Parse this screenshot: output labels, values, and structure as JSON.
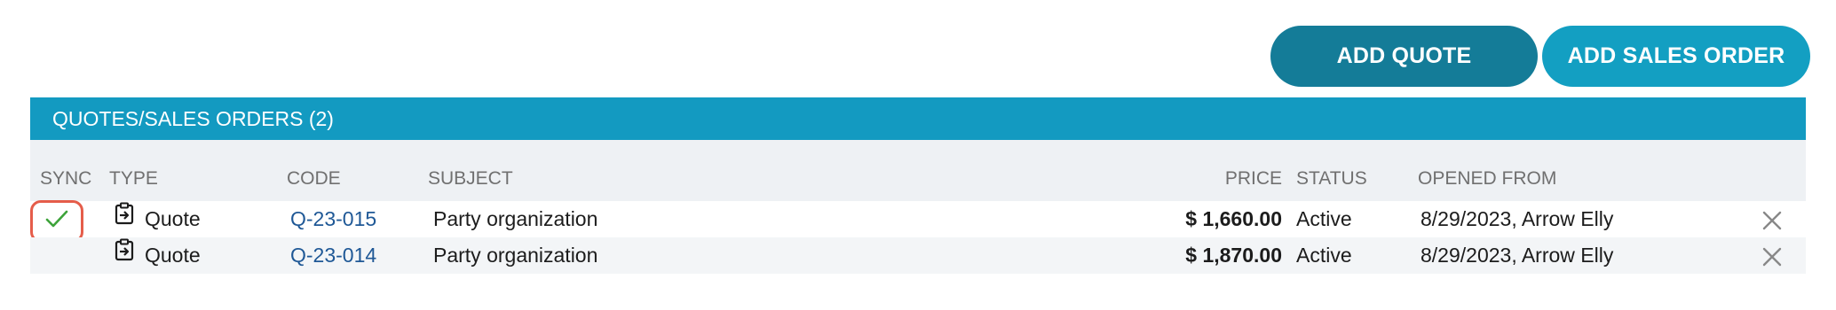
{
  "toolbar": {
    "add_quote_label": "ADD QUOTE",
    "add_sales_order_label": "ADD SALES ORDER"
  },
  "panel": {
    "title": "QUOTES/SALES ORDERS (2)"
  },
  "columns": {
    "sync": "SYNC",
    "type": "TYPE",
    "code": "CODE",
    "subject": "SUBJECT",
    "price": "PRICE",
    "status": "STATUS",
    "opened_from": "OPENED FROM"
  },
  "rows": [
    {
      "synced": true,
      "type": "Quote",
      "type_icon": "clipboard-arrow-icon",
      "code": "Q-23-015",
      "subject": "Party organization",
      "price": "$ 1,660.00",
      "status": "Active",
      "opened_from": "8/29/2023, Arrow Elly"
    },
    {
      "synced": false,
      "type": "Quote",
      "type_icon": "clipboard-arrow-icon",
      "code": "Q-23-014",
      "subject": "Party organization",
      "price": "$ 1,870.00",
      "status": "Active",
      "opened_from": "8/29/2023, Arrow Elly"
    }
  ],
  "colors": {
    "add_quote_button": "#147c98",
    "add_sales_order_button": "#139fc2",
    "panel_header": "#139ac1",
    "sync_check": "#3da33a",
    "highlight_outline": "#e55d4a",
    "code_link": "#1f5896"
  }
}
